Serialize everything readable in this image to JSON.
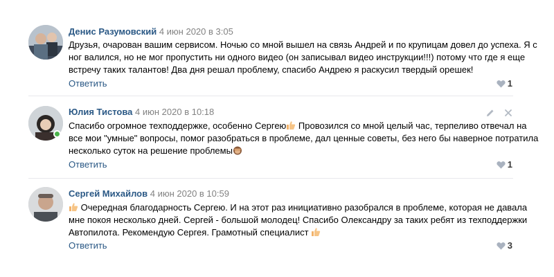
{
  "comments": [
    {
      "author": "Денис Разумовский",
      "date": "4 июн 2020 в 3:05",
      "lines": [
        "Друзья, очарован вашим сервисом. Ночью со мной вышел на связь Андрей и по крупицам довел до успеха. Я с",
        "ног валился, но не мог пропустить ни одного видео (он записывал видео инструкции!!!) потому что где я еще",
        "встречу таких талантов! Два дня решал проблему, спасибо Андрею я раскусил твердый орешек!"
      ],
      "reply_label": "Ответить",
      "likes": "1"
    },
    {
      "author": "Юлия Тистова",
      "date": "4 июн 2020 в 10:18",
      "lines": [
        "Спасибо огромное техподдержке, особенно Сергею",
        " Провозился со мной целый час, терпеливо отвечал на",
        "все мои \"умные\" вопросы, помог разобраться в проблеме, дал ценные советы, без него бы наверное потратила",
        "несколько суток на решение проблемы"
      ],
      "reply_label": "Ответить",
      "likes": "1",
      "online": true,
      "tool_icons": [
        "pencil-icon",
        "close-icon"
      ]
    },
    {
      "author": "Сергей Михайлов",
      "date": "4 июн 2020 в 10:59",
      "lines": [
        " Очередная благодарность Сергею. И на этот раз инициативно разобрался в проблеме, которая не давала",
        "мне покоя несколько дней. Сергей - большой молодец! Спасибо Олександру за таких ребят из техподдержки",
        "Автопилота. Рекомендую Сергея. Грамотный специалист "
      ],
      "reply_label": "Ответить",
      "likes": "3"
    }
  ],
  "colors": {
    "link": "#2a5885",
    "date": "#828282",
    "divider": "#e7e8ec",
    "online": "#4bb34b",
    "heart": "#a9b2bf"
  },
  "icons": {
    "like": "heart-icon",
    "thumbs": "thumbs-up-emoji",
    "monkey": "see-no-evil-monkey-emoji"
  }
}
